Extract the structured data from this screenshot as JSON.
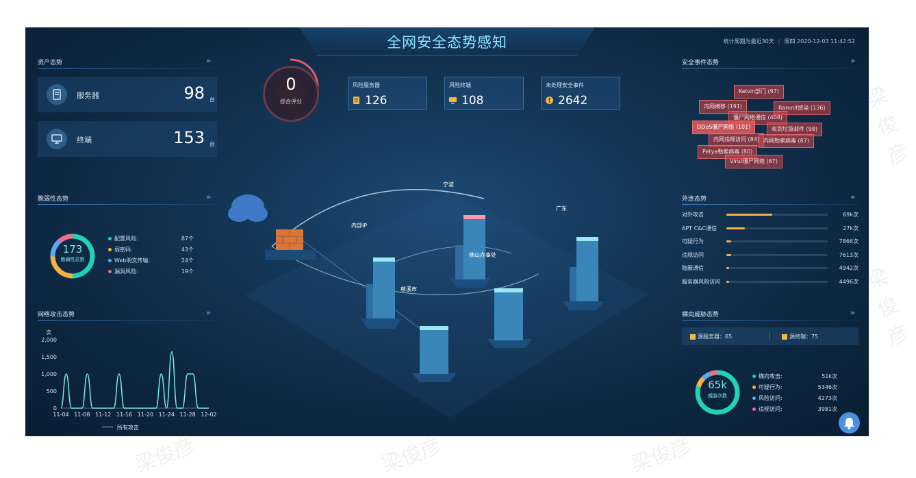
{
  "header": {
    "title": "全网安全态势感知",
    "stat_period": "统计周期为最近30天",
    "datetime": "周四 2020-12-03 11:42:52"
  },
  "assets": {
    "title": "资产态势",
    "server_label": "服务器",
    "server_count": "98",
    "terminal_label": "终端",
    "terminal_count": "153",
    "unit": "台"
  },
  "score": {
    "value": "0",
    "label": "综合评分"
  },
  "risk_stats": [
    {
      "label": "风险服务器",
      "value": "126"
    },
    {
      "label": "风险终端",
      "value": "108"
    },
    {
      "label": "未处理安全事件",
      "value": "2642"
    }
  ],
  "vulnerability": {
    "title": "脆弱性态势",
    "total": "173",
    "total_label": "脆弱性总数",
    "items": [
      {
        "label": "配置风险:",
        "value": "87个",
        "color": "#21d3b4"
      },
      {
        "label": "弱密码:",
        "value": "43个",
        "color": "#f5b044"
      },
      {
        "label": "Web明文传输:",
        "value": "24个",
        "color": "#5aa9f0"
      },
      {
        "label": "漏洞风险:",
        "value": "19个",
        "color": "#ea6f8c"
      }
    ]
  },
  "attack_trend": {
    "title": "网络攻击态势",
    "y_unit": "次",
    "legend": "所有攻击"
  },
  "chart_data": {
    "type": "line",
    "xlabel": "",
    "ylabel": "次",
    "ylim": [
      0,
      2000
    ],
    "yticks": [
      "0",
      "500",
      "1,000",
      "1,500",
      "2,000"
    ],
    "xticks": [
      "11-04",
      "11-08",
      "11-12",
      "11-16",
      "11-20",
      "11-24",
      "11-28",
      "12-02"
    ],
    "x": [
      "11-04",
      "11-05",
      "11-06",
      "11-07",
      "11-08",
      "11-09",
      "11-10",
      "11-11",
      "11-12",
      "11-13",
      "11-14",
      "11-15",
      "11-16",
      "11-17",
      "11-18",
      "11-19",
      "11-20",
      "11-21",
      "11-22",
      "11-23",
      "11-24",
      "11-25",
      "11-26",
      "11-27",
      "11-28",
      "11-29",
      "11-30",
      "12-01",
      "12-02"
    ],
    "series": [
      {
        "name": "所有攻击",
        "color": "#7fe6ef",
        "values": [
          0,
          1000,
          0,
          0,
          0,
          1000,
          0,
          0,
          0,
          0,
          0,
          1000,
          0,
          0,
          0,
          0,
          0,
          0,
          0,
          1000,
          0,
          1650,
          0,
          0,
          1000,
          1000,
          0,
          0,
          0
        ]
      }
    ]
  },
  "security_events": {
    "title": "安全事件态势",
    "tags": [
      "Kelvin部门 (97)",
      "内网横移 (191)",
      "Ramnit感染 (136)",
      "僵尸网络通信 (408)",
      "DDoS僵尸网络 (101)",
      "收到垃圾邮件 (98)",
      "内网违规访问 (84)",
      "内网勒索病毒 (87)",
      "Petya勒索病毒 (80)",
      "Virut僵尸网络 (87)"
    ]
  },
  "outbound": {
    "title": "外连态势",
    "items": [
      {
        "label": "对外攻击",
        "value": "69k次",
        "pct": 0.45
      },
      {
        "label": "APT C&C通信",
        "value": "27k次",
        "pct": 0.18
      },
      {
        "label": "可疑行为",
        "value": "7866次",
        "pct": 0.05
      },
      {
        "label": "违规访问",
        "value": "7613次",
        "pct": 0.05
      },
      {
        "label": "隐蔽通信",
        "value": "4942次",
        "pct": 0.03
      },
      {
        "label": "服务器风险访问",
        "value": "4496次",
        "pct": 0.03
      }
    ]
  },
  "lateral": {
    "title": "横向威胁态势",
    "source_server": "源服务器：65",
    "source_terminal": "源终端：75",
    "total": "65k",
    "total_label": "威胁次数",
    "items": [
      {
        "label": "横向攻击:",
        "value": "51k次",
        "color": "#21d3b4"
      },
      {
        "label": "可疑行为:",
        "value": "5346次",
        "color": "#f5b044"
      },
      {
        "label": "风险访问:",
        "value": "4273次",
        "color": "#5aa9f0"
      },
      {
        "label": "违规访问:",
        "value": "3981次",
        "color": "#ea6f8c"
      }
    ]
  },
  "map": {
    "cities": [
      "宁波",
      "内部IP",
      "佛山办事处",
      "广东",
      "慈溪市"
    ]
  },
  "watermark": "梁俊彦",
  "colors": {
    "accent": "#8fe3ff",
    "warning": "#f5b044",
    "danger": "#e2595b",
    "background": "#0d2741"
  }
}
